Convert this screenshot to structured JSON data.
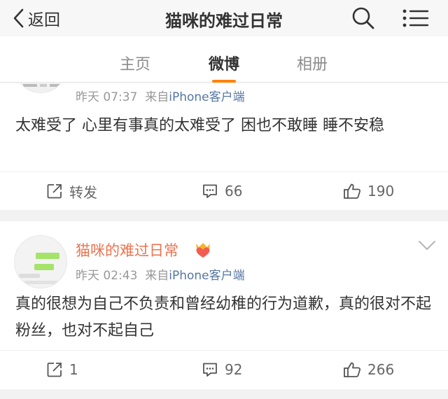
{
  "navbar": {
    "back_label": "返回",
    "title": "猫咪的难过日常",
    "search_icon": "search-icon",
    "more_icon": "more-icon"
  },
  "tabs": [
    {
      "label": "主页",
      "active": false
    },
    {
      "label": "微博",
      "active": true
    },
    {
      "label": "相册",
      "active": false
    }
  ],
  "colors": {
    "accent": "#ff8200",
    "username": "#eb7350",
    "source_link": "#5576a3"
  },
  "posts": [
    {
      "time": "昨天 07:37",
      "source_prefix": "来自",
      "source": "iPhone客户端",
      "text": "太难受了 心里有事真的太难受了 困也不敢睡 睡不安稳",
      "repost": "转发",
      "comments": "66",
      "likes": "190"
    },
    {
      "username": "猫咪的难过日常",
      "vip_icon": "crown-heart-badge-icon",
      "time": "昨天 02:43",
      "source_prefix": "来自",
      "source": "iPhone客户端",
      "text": "真的很想为自己不负责和曾经幼稚的行为道歉，真的很对不起粉丝，也对不起自己",
      "repost": "1",
      "comments": "92",
      "likes": "266"
    }
  ]
}
